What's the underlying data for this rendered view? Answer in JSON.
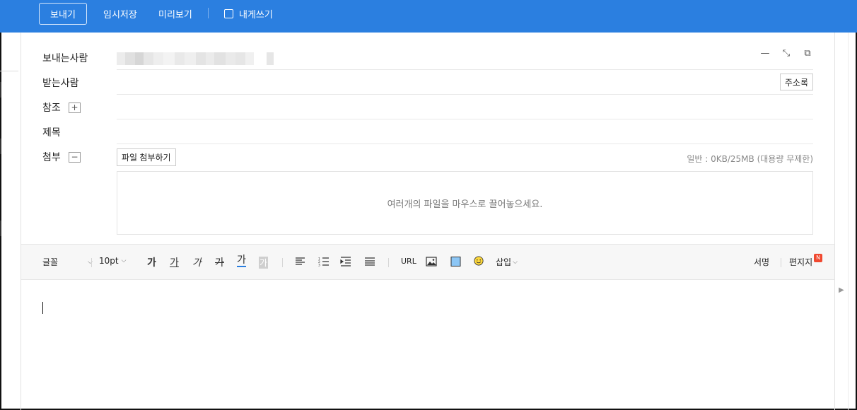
{
  "toolbar": {
    "send_label": "보내기",
    "draft_label": "임시저장",
    "preview_label": "미리보기",
    "to_self_label": "내게쓰기",
    "to_self_checked": false,
    "bg_color": "#2b7fe0"
  },
  "fields": {
    "sender_label": "보내는사람",
    "recipient_label": "받는사람",
    "cc_label": "참조",
    "cc_toggle": "+",
    "subject_label": "제목",
    "attach_label": "첨부",
    "attach_toggle": "−",
    "address_book_label": "주소록"
  },
  "window_controls": {
    "minimize": "—",
    "shrink": "⤡",
    "popout": "⧉"
  },
  "attachment": {
    "button_label": "파일 첨부하기",
    "quota_text": "일반 : 0KB/25MB (대용량 무제한)",
    "dropzone_text": "여러개의 파일을 마우스로 끌어놓으세요."
  },
  "editor_toolbar": {
    "font_label": "글꼴",
    "size_label": "10pt",
    "bold": "가",
    "underline": "가",
    "italic": "가",
    "strike": "가",
    "font_color": "가",
    "bg_color": "가",
    "url_label": "URL",
    "insert_label": "삽입",
    "signature_label": "서명",
    "stationery_label": "편지지",
    "new_badge": "N",
    "accent_color": "#2b7fe0",
    "badge_color": "#f0482f"
  },
  "editor": {
    "content": ""
  }
}
